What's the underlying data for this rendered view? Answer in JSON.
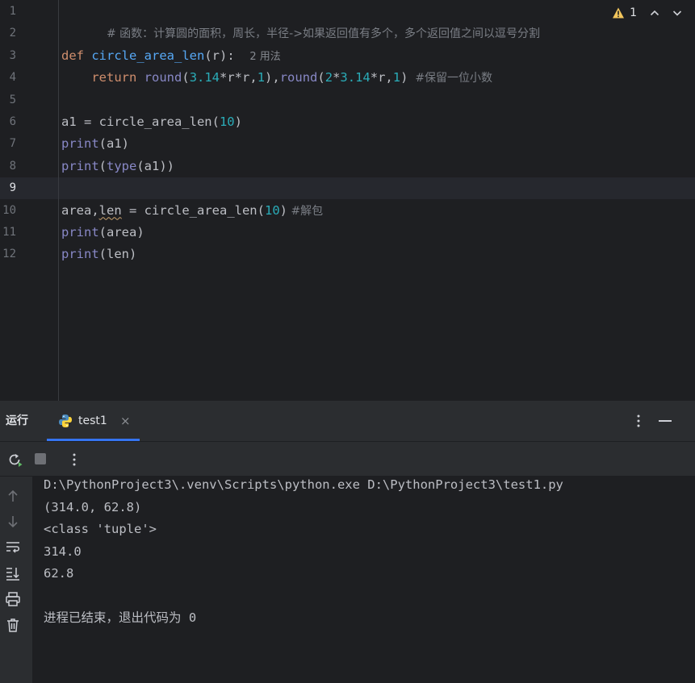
{
  "editor": {
    "line_numbers": [
      "1",
      "2",
      "3",
      "4",
      "5",
      "6",
      "7",
      "8",
      "9",
      "10",
      "11",
      "12"
    ],
    "inspections": {
      "warning_count": "1"
    },
    "lines": {
      "l1": {
        "comment": "# 函数：计算圆的面积，周长，半径->如果返回值有多个，多个返回值之间以逗号分割"
      },
      "l3": {
        "def": "def",
        "name": "circle_area_len",
        "args": "(r):",
        "hint": "2 用法"
      },
      "l4": {
        "indent": "    ",
        "ret": "return",
        "round1": "round",
        "p1": "(",
        "n1": "3.14",
        "t1": "*r*r,",
        "n2": "1",
        "p2": "),",
        "round2": "round",
        "p3": "(",
        "n3": "2",
        "t2": "*",
        "n4": "3.14",
        "t3": "*r,",
        "n5": "1",
        "p4": ")",
        "comment": "  #保留一位小数"
      },
      "l6": {
        "lhs": "a1 = circle_area_len(",
        "num": "10",
        "rp": ")"
      },
      "l7": {
        "fn": "print",
        "arg": "(a1)"
      },
      "l8": {
        "fn": "print",
        "lp": "(",
        "fn2": "type",
        "arg": "(a1))"
      },
      "l10": {
        "pre": "area,",
        "len": "len",
        "mid": " = circle_area_len(",
        "num": "10",
        "rp": ")",
        "comment": " #解包"
      },
      "l11": {
        "fn": "print",
        "arg": "(area)"
      },
      "l12": {
        "fn": "print",
        "arg": "(len)"
      }
    }
  },
  "tool_window": {
    "title": "运行",
    "tab_label": "test1",
    "tab_close": "×"
  },
  "console": {
    "lines": [
      "D:\\PythonProject3\\.venv\\Scripts\\python.exe D:\\PythonProject3\\test1.py",
      "(314.0, 62.8)",
      "<class 'tuple'>",
      "314.0",
      "62.8",
      "",
      "进程已结束，退出代码为 0"
    ]
  },
  "colors": {
    "editor_bg": "#1e1f22",
    "panel_bg": "#2b2d30",
    "keyword": "#cf8e6d",
    "function": "#56a8f5",
    "number": "#2aacb8",
    "builtin": "#8888c6",
    "comment": "#7a7e85",
    "accent": "#3574f0",
    "warning": "#f2c55c"
  },
  "icons": [
    "warning-icon",
    "chevron-up-icon",
    "chevron-down-icon",
    "python-icon",
    "close-icon",
    "more-vertical-icon",
    "minimize-icon",
    "rerun-icon",
    "stop-icon",
    "arrow-up-icon",
    "arrow-down-icon",
    "soft-wrap-icon",
    "scroll-to-end-icon",
    "print-icon",
    "trash-icon"
  ]
}
